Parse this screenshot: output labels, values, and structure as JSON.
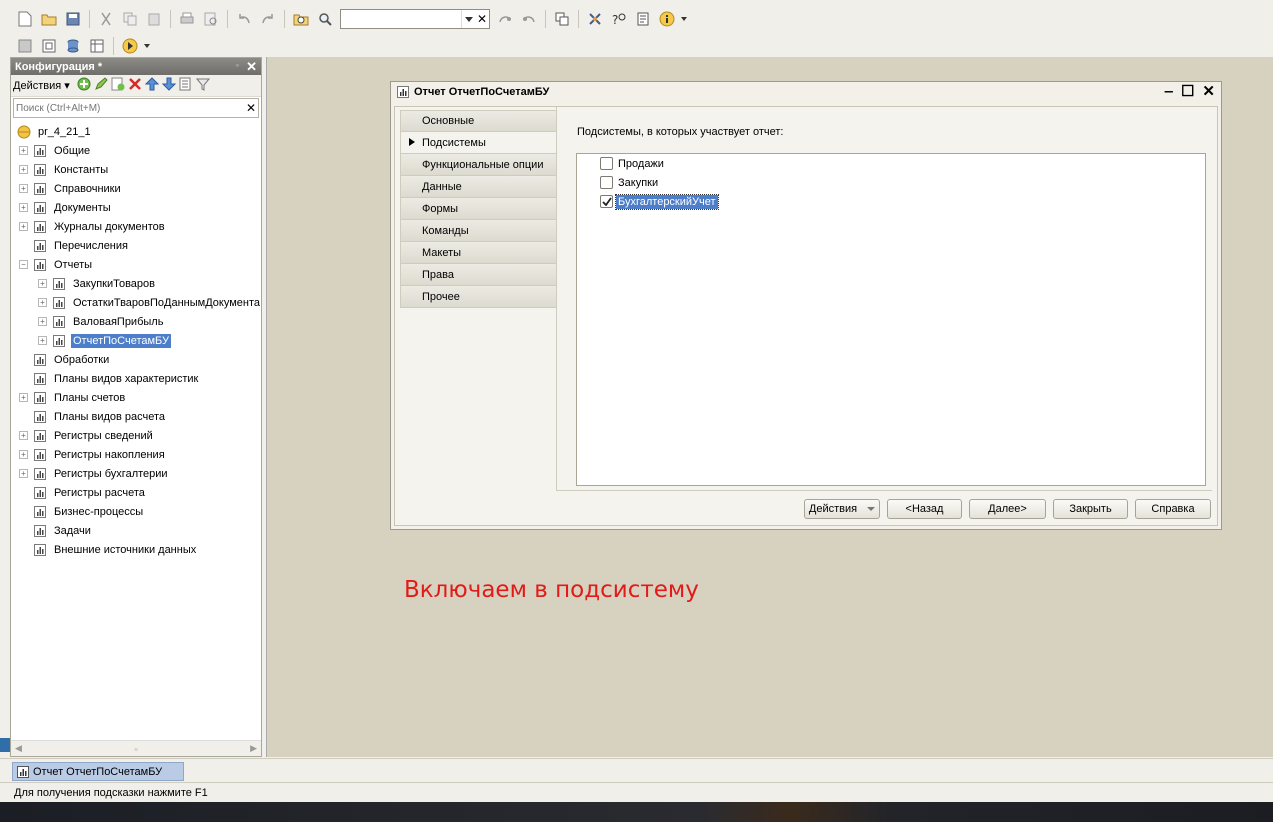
{
  "toolbar": {
    "search_value": "",
    "buttons": [
      "new-document-icon",
      "open-folder-icon",
      "save-icon",
      "cut-icon",
      "copy-icon",
      "paste-icon",
      "print-icon",
      "print-preview-icon",
      "undo-icon",
      "redo-icon",
      "find-in-folder-icon",
      "search-icon",
      "search-next-icon",
      "search-prev-icon",
      "windows-icon",
      "debug-icon",
      "syntax-assistant-icon",
      "template-icon",
      "info-icon"
    ],
    "row2_buttons": [
      "config-icon",
      "database-config-icon",
      "update-db-icon",
      "table-icon",
      "run-debug-icon"
    ]
  },
  "config_panel": {
    "title": "Конфигурация *",
    "actions_label": "Действия",
    "search_placeholder": "Поиск (Ctrl+Alt+M)",
    "root": "pr_4_21_1",
    "items": [
      {
        "label": "Общие",
        "expandable": true,
        "icon": "common-icon"
      },
      {
        "label": "Константы",
        "expandable": true,
        "icon": "constants-icon"
      },
      {
        "label": "Справочники",
        "expandable": true,
        "icon": "catalogs-icon"
      },
      {
        "label": "Документы",
        "expandable": true,
        "icon": "documents-icon"
      },
      {
        "label": "Журналы документов",
        "expandable": true,
        "icon": "journals-icon"
      },
      {
        "label": "Перечисления",
        "expandable": false,
        "icon": "enums-icon"
      },
      {
        "label": "Отчеты",
        "expandable": true,
        "expanded": true,
        "icon": "reports-icon"
      },
      {
        "label": "ЗакупкиТоваров",
        "child": true,
        "icon": "report-icon"
      },
      {
        "label": "ОстаткиТваровПоДаннымДокумента",
        "child": true,
        "icon": "report-icon"
      },
      {
        "label": "ВаловаяПрибыль",
        "child": true,
        "icon": "report-icon"
      },
      {
        "label": "ОтчетПоСчетамБУ",
        "child": true,
        "selected": true,
        "icon": "report-icon"
      },
      {
        "label": "Обработки",
        "expandable": false,
        "icon": "processing-icon"
      },
      {
        "label": "Планы видов характеристик",
        "expandable": false,
        "icon": "chart-types-icon"
      },
      {
        "label": "Планы счетов",
        "expandable": true,
        "icon": "chart-accounts-icon"
      },
      {
        "label": "Планы видов расчета",
        "expandable": false,
        "icon": "calc-types-icon"
      },
      {
        "label": "Регистры сведений",
        "expandable": true,
        "icon": "info-registers-icon"
      },
      {
        "label": "Регистры накопления",
        "expandable": true,
        "icon": "accum-registers-icon"
      },
      {
        "label": "Регистры бухгалтерии",
        "expandable": true,
        "icon": "accounting-registers-icon"
      },
      {
        "label": "Регистры расчета",
        "expandable": false,
        "icon": "calc-registers-icon"
      },
      {
        "label": "Бизнес-процессы",
        "expandable": false,
        "icon": "business-process-icon"
      },
      {
        "label": "Задачи",
        "expandable": false,
        "icon": "tasks-icon"
      },
      {
        "label": "Внешние источники данных",
        "expandable": false,
        "icon": "external-sources-icon"
      }
    ]
  },
  "window": {
    "title": "Отчет ОтчетПоСчетамБУ",
    "tabs": [
      "Основные",
      "Подсистемы",
      "Функциональные опции",
      "Данные",
      "Формы",
      "Команды",
      "Макеты",
      "Права",
      "Прочее"
    ],
    "active_tab": "Подсистемы",
    "panel_label": "Подсистемы, в которых участвует отчет:",
    "subsystems": [
      {
        "label": "Продажи",
        "checked": false
      },
      {
        "label": "Закупки",
        "checked": false
      },
      {
        "label": "БухгалтерскийУчет",
        "checked": true,
        "selected": true
      }
    ],
    "buttons": {
      "actions": "Действия",
      "back": "<Назад",
      "next": "Далее>",
      "close": "Закрыть",
      "help": "Справка"
    }
  },
  "caption": "Включаем в подсистему",
  "taskbar": {
    "item": "Отчет ОтчетПоСчетамБУ"
  },
  "status": "Для получения подсказки нажмите F1",
  "colors": {
    "selection": "#4d7ec9",
    "caption": "#e21a1a",
    "workspace": "#d6d2bf"
  }
}
